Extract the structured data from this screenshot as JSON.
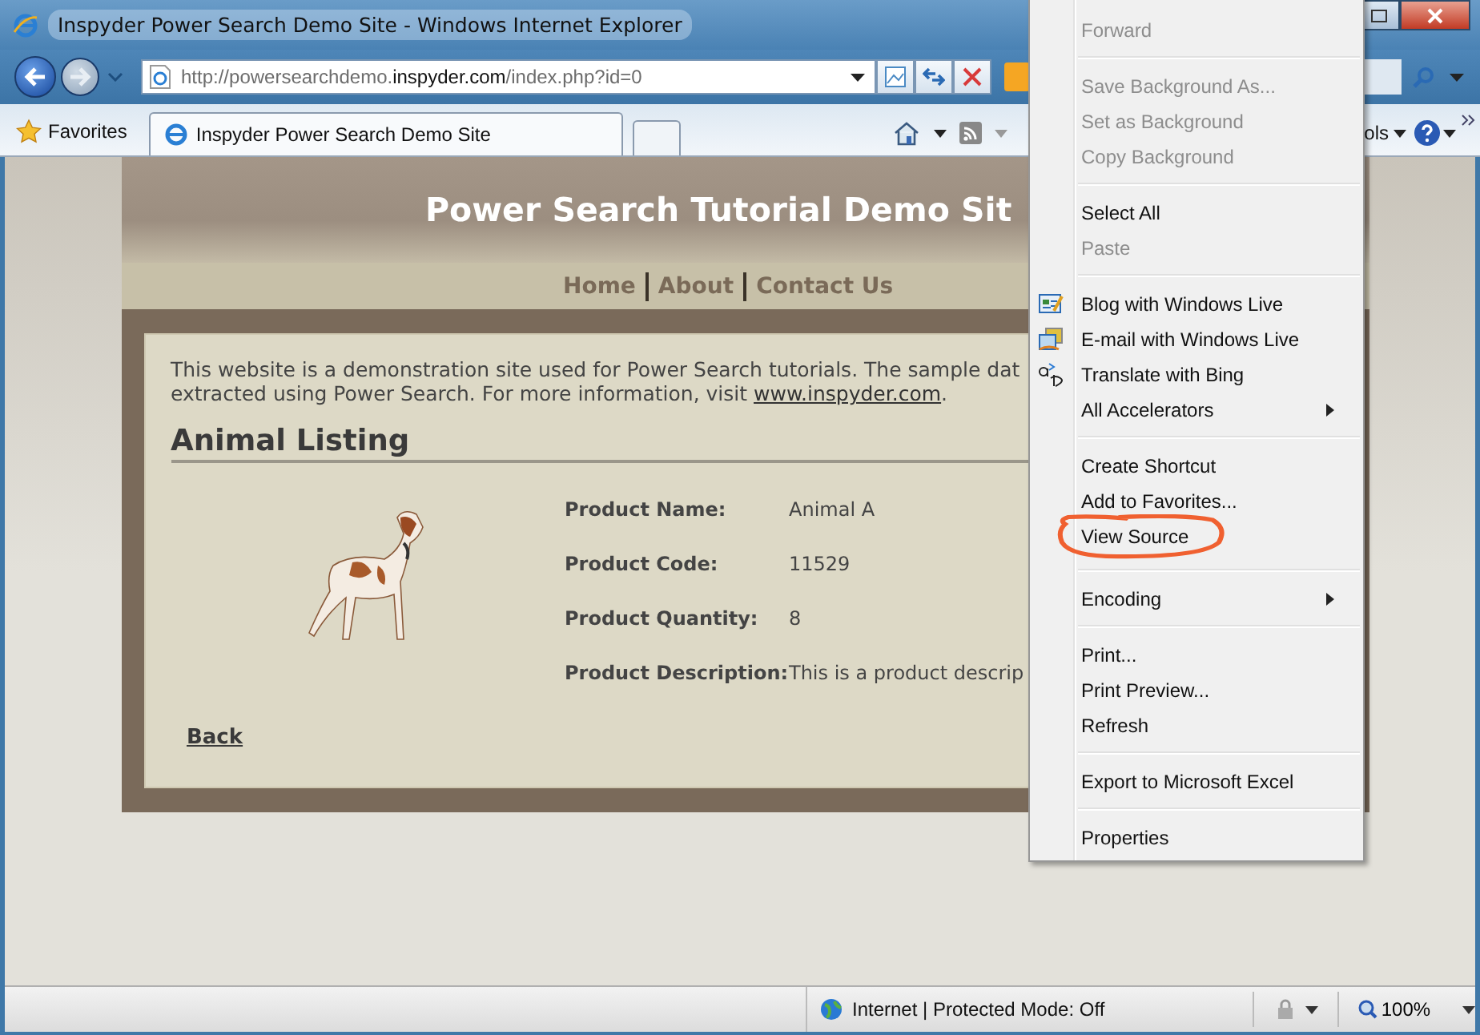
{
  "window": {
    "title": "Inspyder Power Search Demo Site - Windows Internet Explorer"
  },
  "address_bar": {
    "prefix": "http://powersearchdemo.",
    "domain": "inspyder.com",
    "suffix": "/index.php?id=0"
  },
  "favorites": {
    "label": "Favorites"
  },
  "tabs": [
    {
      "label": "Inspyder Power Search Demo Site",
      "selected": true
    }
  ],
  "command_bar": {
    "tools_label": "ols"
  },
  "page": {
    "site_title": "Power Search Tutorial Demo Sit",
    "nav": [
      "Home",
      "About",
      "Contact Us"
    ],
    "intro_line_1": "This website is a demonstration site used for Power Search tutorials. The sample dat",
    "intro_line_2": "extracted using Power Search. For more information, visit ",
    "intro_link": "www.inspyder.com",
    "intro_end": ".",
    "heading": "Animal Listing",
    "fields": [
      {
        "label": "Product Name:",
        "value": "Animal A"
      },
      {
        "label": "Product Code:",
        "value": "11529"
      },
      {
        "label": "Product Quantity:",
        "value": "8"
      },
      {
        "label": "Product Description:",
        "value": "This is a product descrip"
      }
    ],
    "back_link": "Back"
  },
  "context_menu": [
    {
      "kind": "item",
      "label": "Forward",
      "disabled": true,
      "submenu": false
    },
    {
      "kind": "separator"
    },
    {
      "kind": "item",
      "label": "Save Background As...",
      "disabled": true,
      "submenu": false
    },
    {
      "kind": "item",
      "label": "Set as Background",
      "disabled": true,
      "submenu": false
    },
    {
      "kind": "item",
      "label": "Copy Background",
      "disabled": true,
      "submenu": false
    },
    {
      "kind": "separator"
    },
    {
      "kind": "item",
      "label": "Select All",
      "disabled": false,
      "submenu": false
    },
    {
      "kind": "item",
      "label": "Paste",
      "disabled": true,
      "submenu": false
    },
    {
      "kind": "separator"
    },
    {
      "kind": "accelerator",
      "label": "Blog with Windows Live",
      "disabled": false,
      "submenu": false
    },
    {
      "kind": "accelerator",
      "label": "E-mail with Windows Live",
      "disabled": false,
      "submenu": false
    },
    {
      "kind": "accelerator",
      "label": "Translate with Bing",
      "disabled": false,
      "submenu": false
    },
    {
      "kind": "item",
      "label": "All Accelerators",
      "disabled": false,
      "submenu": true
    },
    {
      "kind": "separator"
    },
    {
      "kind": "item",
      "label": "Create Shortcut",
      "disabled": false,
      "submenu": false
    },
    {
      "kind": "item",
      "label": "Add to Favorites...",
      "disabled": false,
      "submenu": false
    },
    {
      "kind": "item",
      "label": "View Source",
      "disabled": false,
      "submenu": false,
      "circled": true
    },
    {
      "kind": "separator"
    },
    {
      "kind": "item",
      "label": "Encoding",
      "disabled": false,
      "submenu": true
    },
    {
      "kind": "separator"
    },
    {
      "kind": "item",
      "label": "Print...",
      "disabled": false,
      "submenu": false
    },
    {
      "kind": "item",
      "label": "Print Preview...",
      "disabled": false,
      "submenu": false
    },
    {
      "kind": "item",
      "label": "Refresh",
      "disabled": false,
      "submenu": false
    },
    {
      "kind": "separator"
    },
    {
      "kind": "item",
      "label": "Export to Microsoft Excel",
      "disabled": false,
      "submenu": false
    },
    {
      "kind": "separator"
    },
    {
      "kind": "item",
      "label": "Properties",
      "disabled": false,
      "submenu": false
    }
  ],
  "status_bar": {
    "zone": "Internet | Protected Mode: Off",
    "zoom": "100%"
  }
}
